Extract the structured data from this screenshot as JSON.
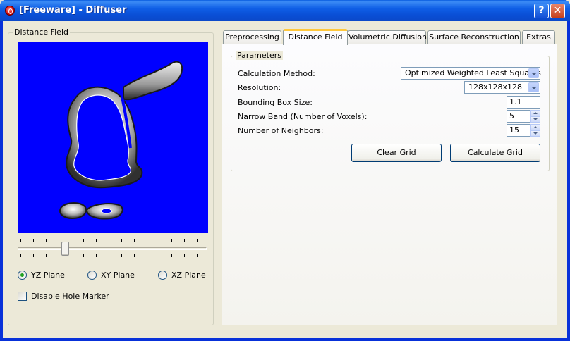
{
  "window": {
    "title": "[Freeware] - Diffuser",
    "help_label": "?",
    "close_label": "✕"
  },
  "left_panel": {
    "group_title": "Distance Field",
    "planes": [
      {
        "label": "YZ Plane",
        "checked": true
      },
      {
        "label": "XY Plane",
        "checked": false
      },
      {
        "label": "XZ Plane",
        "checked": false
      }
    ],
    "disable_hole_marker": {
      "label": "Disable Hole Marker",
      "checked": false
    },
    "slider": {
      "position": 0.26,
      "tick_count": 15
    }
  },
  "tabs": [
    {
      "label": "Preprocessing",
      "active": false
    },
    {
      "label": "Distance Field",
      "active": true
    },
    {
      "label": "Volumetric Diffusion",
      "active": false
    },
    {
      "label": "Surface Reconstruction",
      "active": false
    },
    {
      "label": "Extras",
      "active": false
    }
  ],
  "parameters": {
    "group_title": "Parameters",
    "calculation_method_label": "Calculation  Method:",
    "calculation_method_value": "Optimized Weighted Least Squares",
    "resolution_label": "Resolution:",
    "resolution_value": "128x128x128",
    "bounding_box_label": "Bounding Box Size:",
    "bounding_box_value": "1.1",
    "narrow_band_label": "Narrow Band (Number of Voxels):",
    "narrow_band_value": "5",
    "neighbors_label": "Number of Neighbors:",
    "neighbors_value": "15",
    "clear_grid_label": "Clear Grid",
    "calculate_grid_label": "Calculate Grid"
  },
  "colors": {
    "preview_background": "#0000ff",
    "titlebar": "#0a4fd6",
    "panel": "#ece9d8"
  }
}
